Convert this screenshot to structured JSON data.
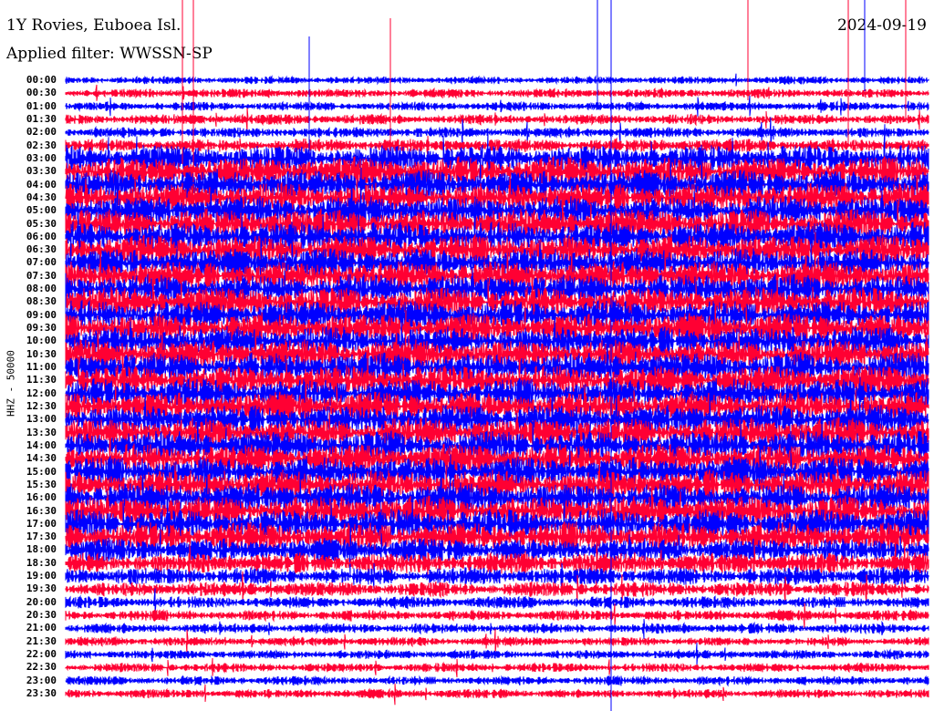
{
  "header": {
    "station": "1Y Rovies, Euboea Isl.",
    "filter": "Applied filter: WWSSN-SP",
    "date": "2024-09-19"
  },
  "chart_data": {
    "type": "line",
    "title": "1Y Rovies, Euboea Isl.",
    "ylabel": "HHZ - 50000",
    "xlabel": "",
    "row_labels": [
      "00:00",
      "00:30",
      "01:00",
      "01:30",
      "02:00",
      "02:30",
      "03:00",
      "03:30",
      "04:00",
      "04:30",
      "05:00",
      "05:30",
      "06:00",
      "06:30",
      "07:00",
      "07:30",
      "08:00",
      "08:30",
      "09:00",
      "09:30",
      "10:00",
      "10:30",
      "11:00",
      "11:30",
      "12:00",
      "12:30",
      "13:00",
      "13:30",
      "14:00",
      "14:30",
      "15:00",
      "15:30",
      "16:00",
      "16:30",
      "17:00",
      "17:30",
      "18:00",
      "18:30",
      "19:00",
      "19:30",
      "20:00",
      "20:30",
      "21:00",
      "21:30",
      "22:00",
      "22:30",
      "23:00",
      "23:30"
    ],
    "series_colors": [
      "#0000ff",
      "#ff0033"
    ],
    "relative_amplitude": [
      0.25,
      0.3,
      0.3,
      0.35,
      0.35,
      0.45,
      0.9,
      1,
      1,
      1,
      1,
      1,
      1,
      1,
      1,
      1,
      1,
      1,
      1,
      1,
      1,
      1,
      1,
      1,
      1,
      1,
      1,
      1,
      1,
      1,
      1,
      1,
      1,
      1,
      1,
      1,
      0.8,
      0.7,
      0.6,
      0.5,
      0.4,
      0.35,
      0.35,
      0.3,
      0.3,
      0.3,
      0.3,
      0.3
    ],
    "minutes_per_row": 30
  }
}
